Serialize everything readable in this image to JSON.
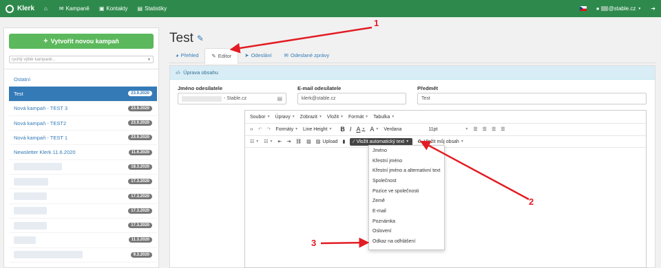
{
  "navbar": {
    "brand": "Klerk",
    "items": [
      {
        "label": "Kampaně",
        "icon": "envelope-icon"
      },
      {
        "label": "Kontakty",
        "icon": "contacts-icon"
      },
      {
        "label": "Statistiky",
        "icon": "chart-icon"
      }
    ],
    "user_suffix": "@stable.cz"
  },
  "sidebar": {
    "new_campaign": "Vytvořit novou kampaň",
    "quick_select_placeholder": "rychlý výběr kampaně...",
    "campaigns": [
      {
        "name": "Ostatní",
        "date": ""
      },
      {
        "name": "Test",
        "date": "23.9.2020",
        "active": true
      },
      {
        "name": "Nová kampaň - TEST 3",
        "date": "23.9.2020"
      },
      {
        "name": "Nová kampaň - TEST2",
        "date": "23.9.2020"
      },
      {
        "name": "Nová kampaň - TEST 1",
        "date": "23.9.2020"
      },
      {
        "name": "Newsletter Klerk 11.6.2020",
        "date": "11.6.2020"
      },
      {
        "name": "",
        "date": "18.3.2020"
      },
      {
        "name": "",
        "date": "17.3.2020"
      },
      {
        "name": "",
        "date": "17.3.2020"
      },
      {
        "name": "",
        "date": "17.3.2020"
      },
      {
        "name": "",
        "date": "17.3.2020"
      },
      {
        "name": "",
        "date": "11.3.2020"
      },
      {
        "name": "",
        "date": "9.3.2020"
      }
    ]
  },
  "main": {
    "title": "Test",
    "tabs": [
      {
        "label": "Přehled",
        "icon": "pie-icon"
      },
      {
        "label": "Editor",
        "icon": "pencil-icon",
        "active": true
      },
      {
        "label": "Odeslání",
        "icon": "send-icon"
      },
      {
        "label": "Odeslané zprávy",
        "icon": "envelope-icon"
      }
    ],
    "panel_title": "Úprava obsahu",
    "sender_name_label": "Jméno odesílatele",
    "sender_name_value": "- Stable.cz",
    "email_label": "E-mail odesílatele",
    "email_value": "klerk@stable.cz",
    "subject_label": "Předmět",
    "subject_value": "Test"
  },
  "editor": {
    "menu": [
      "Soubor",
      "Úpravy",
      "Zobrazit",
      "Vložit",
      "Formát",
      "Tabulka"
    ],
    "formats": "Formáty",
    "line_height": "Line Height",
    "font": "Verdana",
    "size": "11pt",
    "upload": "Upload",
    "auto_text": "Vložit automatický text",
    "my_content": "Vložit můj obsah",
    "dropdown": [
      "Jméno",
      "Křestní jméno",
      "Křestní jméno a alternativní text",
      "Společnost",
      "Pozice ve společnosti",
      "Země",
      "E-mail",
      "Poznámka",
      "Oslovení",
      "Odkaz na odhlášení"
    ]
  },
  "annotations": {
    "m1": "1",
    "m2": "2",
    "m3": "3",
    "color": "#e31b23"
  }
}
